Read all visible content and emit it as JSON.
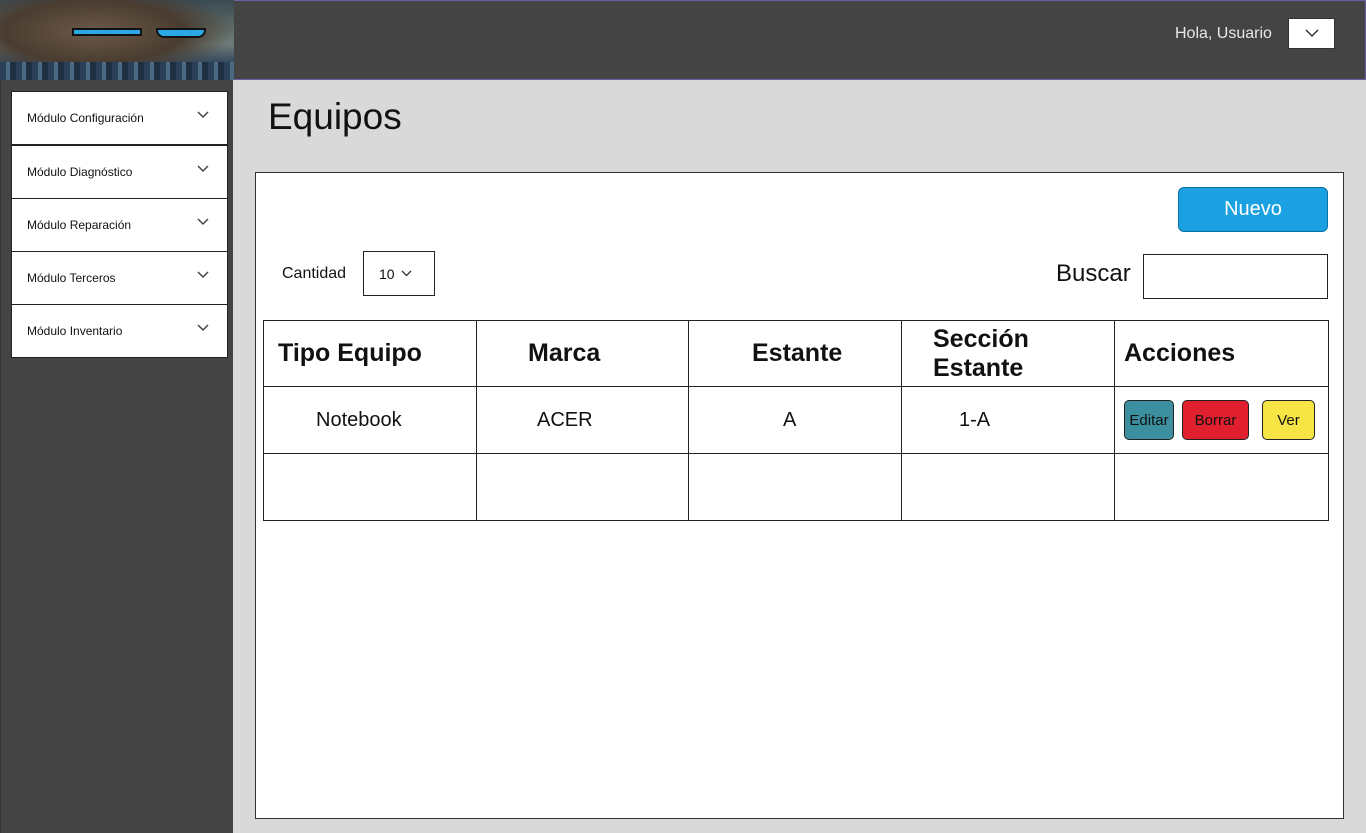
{
  "header": {
    "greeting": "Hola, Usuario"
  },
  "sidebar": {
    "items": [
      {
        "label": "Módulo Configuración"
      },
      {
        "label": "Módulo Diagnóstico"
      },
      {
        "label": "Módulo Reparación"
      },
      {
        "label": "Módulo Terceros"
      },
      {
        "label": "Módulo Inventario"
      }
    ]
  },
  "page": {
    "title": "Equipos"
  },
  "toolbar": {
    "new_label": "Nuevo"
  },
  "filters": {
    "quantity_label": "Cantidad",
    "quantity_value": "10",
    "search_label": "Buscar",
    "search_value": ""
  },
  "table": {
    "headers": [
      "Tipo Equipo",
      "Marca",
      "Estante",
      "Sección Estante",
      "Acciones"
    ],
    "rows": [
      {
        "tipo": "Notebook",
        "marca": "ACER",
        "estante": "A",
        "seccion": "1-A"
      }
    ],
    "actions": {
      "edit": "Editar",
      "delete": "Borrar",
      "view": "Ver"
    }
  },
  "colors": {
    "primary": "#1ba1e2",
    "edit": "#3b8f9e",
    "delete": "#e0202e",
    "view": "#f7e545",
    "chrome": "#444444",
    "background": "#d9d9d9"
  },
  "icons": {
    "dropdown": "chevron-down-icon",
    "logo": "capybara-sunglasses-logo"
  }
}
